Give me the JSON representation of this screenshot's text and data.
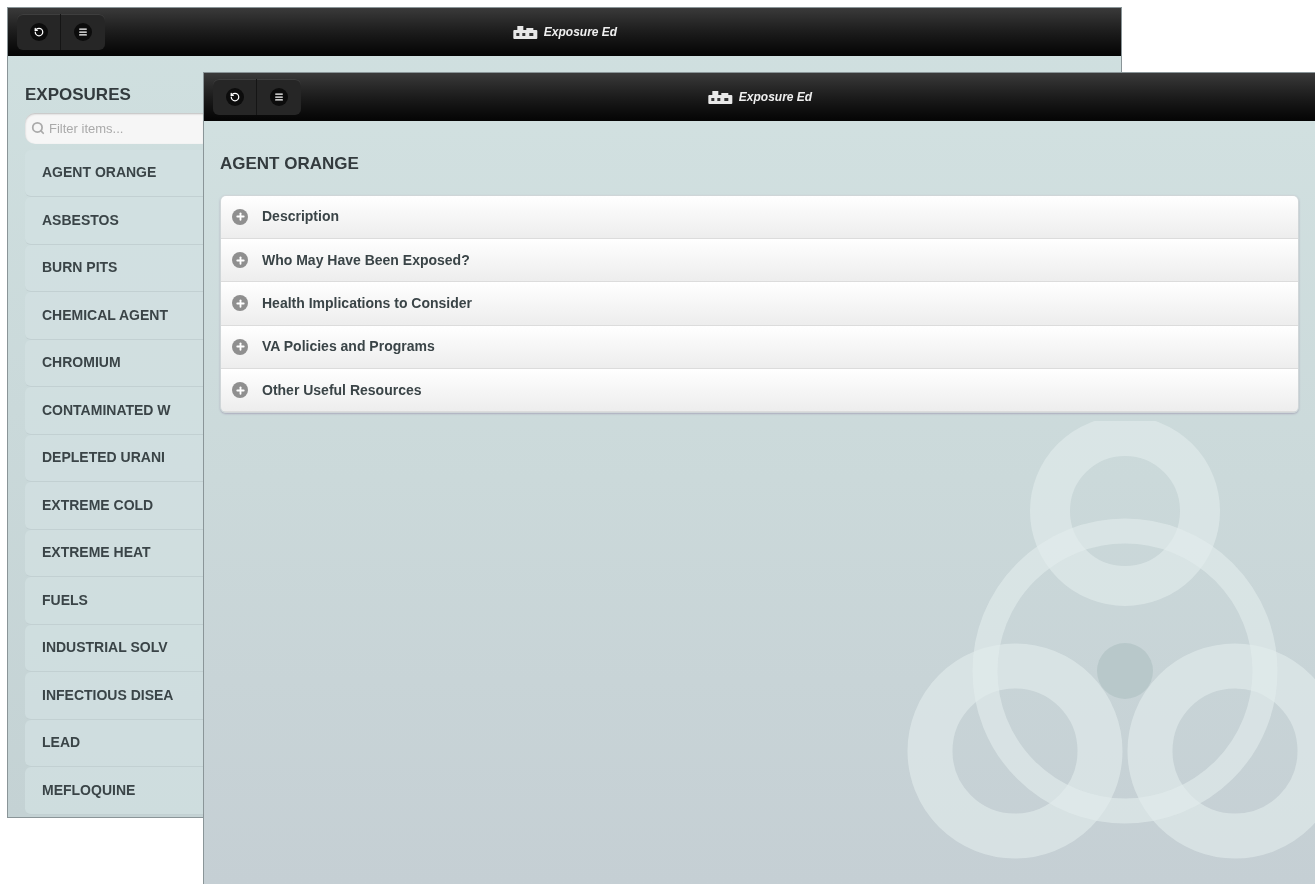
{
  "windows": [
    {
      "kind": "list",
      "app_title": "Exposure Ed",
      "heading": "EXPOSURES",
      "filter": {
        "placeholder": "Filter items..."
      },
      "items": [
        {
          "label": "AGENT ORANGE"
        },
        {
          "label": "ASBESTOS"
        },
        {
          "label": "BURN PITS"
        },
        {
          "label": "CHEMICAL AGENT"
        },
        {
          "label": "CHROMIUM"
        },
        {
          "label": "CONTAMINATED W"
        },
        {
          "label": "DEPLETED URANI"
        },
        {
          "label": "EXTREME COLD"
        },
        {
          "label": "EXTREME HEAT"
        },
        {
          "label": "FUELS"
        },
        {
          "label": "INDUSTRIAL SOLV"
        },
        {
          "label": "INFECTIOUS DISEA"
        },
        {
          "label": "LEAD"
        },
        {
          "label": "MEFLOQUINE"
        }
      ]
    },
    {
      "kind": "detail",
      "app_title": "Exposure Ed",
      "heading": "AGENT ORANGE",
      "sections": [
        {
          "label": "Description",
          "expanded": false
        },
        {
          "label": "Who May Have Been Exposed?",
          "expanded": false
        },
        {
          "label": "Health Implications to Consider",
          "expanded": false
        },
        {
          "label": "VA Policies and Programs",
          "expanded": false
        },
        {
          "label": "Other Useful Resources",
          "expanded": false
        }
      ]
    }
  ]
}
